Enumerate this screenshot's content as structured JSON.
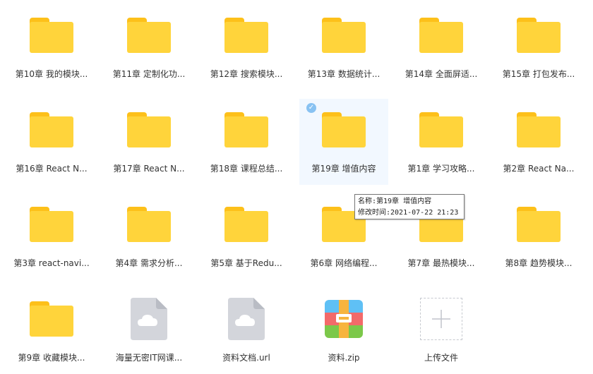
{
  "files": [
    {
      "name": "第10章 我的模块...",
      "type": "folder"
    },
    {
      "name": "第11章 定制化功...",
      "type": "folder"
    },
    {
      "name": "第12章 搜索模块...",
      "type": "folder"
    },
    {
      "name": "第13章 数据统计...",
      "type": "folder"
    },
    {
      "name": "第14章 全面屏适...",
      "type": "folder"
    },
    {
      "name": "第15章 打包发布...",
      "type": "folder"
    },
    {
      "name": "第16章 React N...",
      "type": "folder"
    },
    {
      "name": "第17章 React N...",
      "type": "folder"
    },
    {
      "name": "第18章 课程总结...",
      "type": "folder"
    },
    {
      "name": "第19章 增值内容",
      "type": "folder",
      "selected": true
    },
    {
      "name": "第1章 学习攻略...",
      "type": "folder"
    },
    {
      "name": "第2章 React Na...",
      "type": "folder"
    },
    {
      "name": "第3章 react-navi...",
      "type": "folder"
    },
    {
      "name": "第4章 需求分析...",
      "type": "folder"
    },
    {
      "name": "第5章 基于Redu...",
      "type": "folder"
    },
    {
      "name": "第6章 网络编程...",
      "type": "folder"
    },
    {
      "name": "第7章 最热模块...",
      "type": "folder"
    },
    {
      "name": "第8章 趋势模块...",
      "type": "folder"
    },
    {
      "name": "第9章 收藏模块...",
      "type": "folder"
    },
    {
      "name": "海量无密IT网课...",
      "type": "cloud-doc"
    },
    {
      "name": "资料文档.url",
      "type": "cloud-doc"
    },
    {
      "name": "资料.zip",
      "type": "zip"
    },
    {
      "name": "上传文件",
      "type": "upload"
    }
  ],
  "tooltip": {
    "line1": "名称:第19章 增值内容",
    "line2": "修改时间:2021-07-22 21:23"
  },
  "colors": {
    "folder_body": "#ffd43b",
    "folder_tab": "#fdc01a",
    "selection_bg": "#f2f8ff",
    "check": "#88c2f2"
  },
  "icons": {
    "folder": "folder-icon",
    "cloud-doc": "cloud-document-icon",
    "zip": "zip-archive-icon",
    "upload": "plus-icon",
    "selected": "check-circle-icon"
  }
}
